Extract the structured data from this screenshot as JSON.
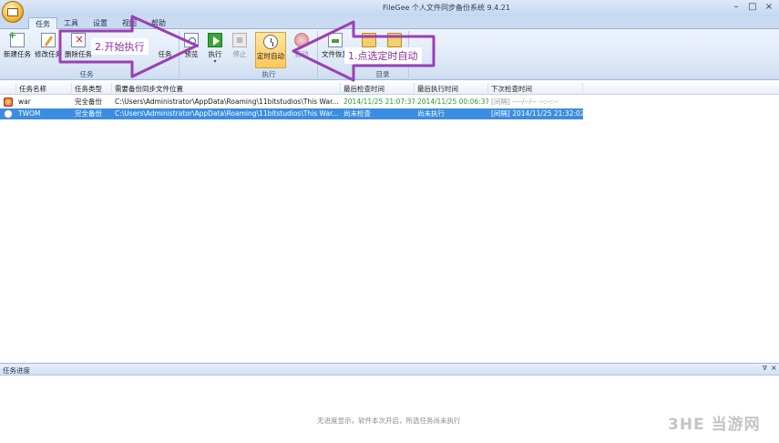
{
  "window": {
    "title": "FileGee 个人文件同步备份系统 9.4.21",
    "app_icon": "filegee-orb-icon",
    "controls": [
      "–",
      "□",
      "×"
    ]
  },
  "tabs": [
    {
      "label": "任务",
      "active": true
    },
    {
      "label": "工具",
      "active": false
    },
    {
      "label": "设置",
      "active": false
    },
    {
      "label": "视图",
      "active": false
    },
    {
      "label": "帮助",
      "active": false
    }
  ],
  "ribbon": {
    "task_group": {
      "label": "任务",
      "buttons": {
        "new": "新建任务",
        "edit": "修改任务",
        "delete": "删除任务",
        "other": "任务"
      }
    },
    "exec_group": {
      "label": "执行",
      "buttons": {
        "preview": "预览",
        "run": "执行",
        "stop": "停止",
        "timer": "定时自动",
        "auto": "自动"
      }
    },
    "dir_group": {
      "label": "目录",
      "buttons": {
        "restore": "文件恢复"
      }
    }
  },
  "table": {
    "columns": [
      "任务名称",
      "任务类型",
      "需要备份同步文件位置",
      "最后检查时间",
      "最后执行时间",
      "下次检查时间"
    ],
    "rows": [
      {
        "name": "war",
        "type": "完全备份",
        "path": "C:\\Users\\Administrator\\AppData\\Roaming\\11bitstudios\\This War...",
        "last_check": "2014/11/25 21:07:37",
        "last_run": "2014/11/25 00:06:37",
        "next_check": "[间隔] ----/--/-- --:--:--",
        "selected": false
      },
      {
        "name": "TWOM",
        "type": "完全备份",
        "path": "C:\\Users\\Administrator\\AppData\\Roaming\\11bitstudios\\This War...",
        "last_check": "尚未检查",
        "last_run": "尚未执行",
        "next_check": "[间隔] 2014/11/25 21:32:02",
        "selected": true
      }
    ]
  },
  "progress_panel": {
    "title": "任务进度",
    "pin": "ᐁ",
    "close": "×",
    "message": "无进度显示，软件本次开启，所选任务尚未执行"
  },
  "annotations": {
    "step1": "1.点选定时自动",
    "step2": "2.开始执行",
    "arrow_color": "#9b3fb5"
  },
  "watermark": "3HE 当游网"
}
